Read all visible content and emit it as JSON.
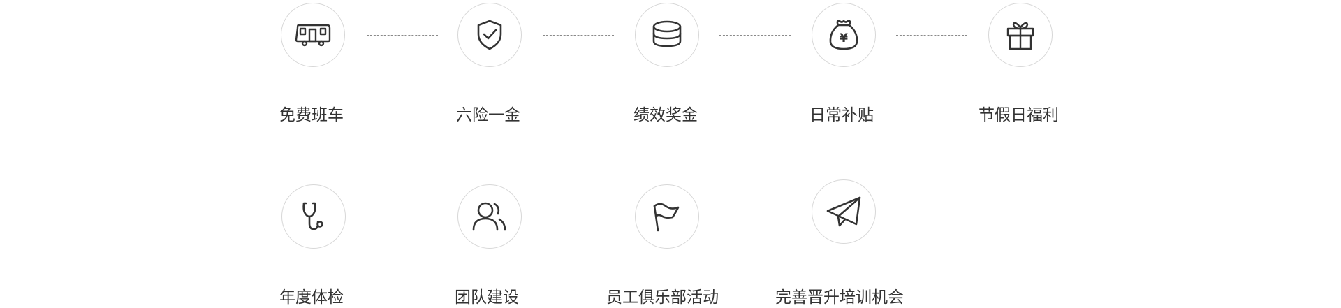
{
  "benefits": {
    "row1": [
      {
        "label": "免费班车",
        "icon": "shuttle-bus-icon"
      },
      {
        "label": "六险一金",
        "icon": "shield-check-icon"
      },
      {
        "label": "绩效奖金",
        "icon": "coin-stack-icon"
      },
      {
        "label": "日常补贴",
        "icon": "money-bag-icon",
        "symbol": "¥"
      },
      {
        "label": "节假日福利",
        "icon": "gift-icon"
      }
    ],
    "row2": [
      {
        "label": "年度体检",
        "icon": "stethoscope-icon"
      },
      {
        "label": "团队建设",
        "icon": "team-users-icon"
      },
      {
        "label": "员工俱乐部活动",
        "icon": "flag-icon"
      },
      {
        "label": "完善晋升培训机会",
        "icon": "paper-plane-icon"
      }
    ]
  },
  "colors": {
    "icon_stroke": "#333333",
    "circle_border": "#d7d7d7",
    "connector": "#8a8a8a",
    "text": "#333333"
  }
}
